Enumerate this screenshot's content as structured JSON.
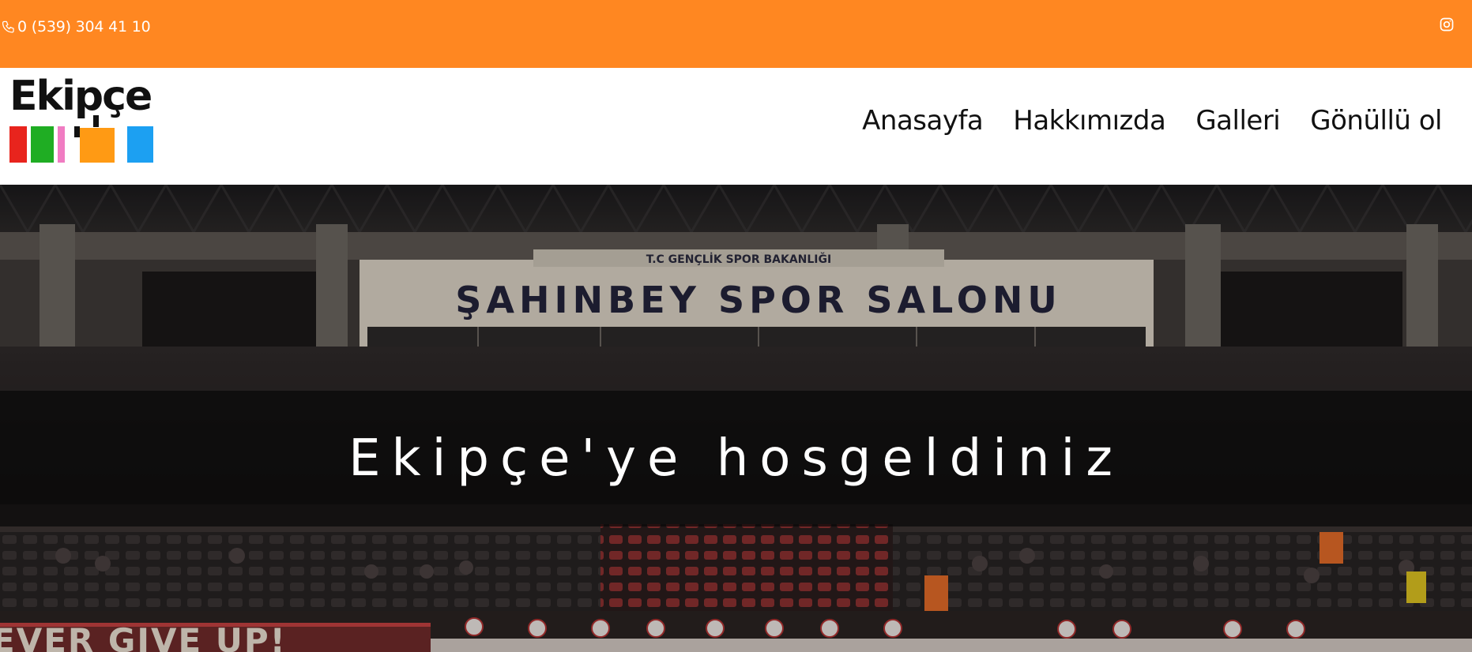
{
  "topbar": {
    "phone": "0 (539) 304 41 10",
    "phone_icon": "phone-icon",
    "instagram_icon": "instagram-icon",
    "background": "#ff8721"
  },
  "header": {
    "logo_text": "Ekipçe",
    "logo_colors": [
      "#e8241d",
      "#1fad23",
      "#f07cc2",
      "#ff9a14",
      "#1ca0f2"
    ]
  },
  "nav": {
    "items": [
      {
        "label": "Anasayfa"
      },
      {
        "label": "Hakkımızda"
      },
      {
        "label": "Galleri"
      },
      {
        "label": "Gönüllü ol"
      }
    ]
  },
  "hero": {
    "title": "Ekipçe'ye hosgeldiniz",
    "sign_small": "T.C GENÇLİK SPOR BAKANLIĞI",
    "sign_main": "ŞAHINBEY SPOR SALONU",
    "banner": "EVER GIVE UP!"
  }
}
